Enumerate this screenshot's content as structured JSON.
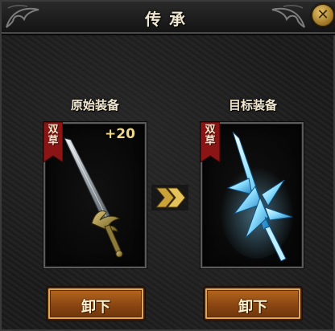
{
  "window": {
    "title": "传承",
    "close_icon": "close-x-icon"
  },
  "source": {
    "label": "原始装备",
    "badge": "双草",
    "enhance": "+20",
    "item_icon": "gold-hilt-sword-icon",
    "unequip_label": "卸下"
  },
  "target": {
    "label": "目标装备",
    "badge": "双草",
    "item_icon": "ice-crystal-sword-icon",
    "unequip_label": "卸下"
  },
  "transfer_icon": "double-chevron-right-icon",
  "colors": {
    "title_text": "#efe6cf",
    "enhance_text": "#f2d98a",
    "button_orange": "#8a4612",
    "badge_red": "#8b1414"
  }
}
